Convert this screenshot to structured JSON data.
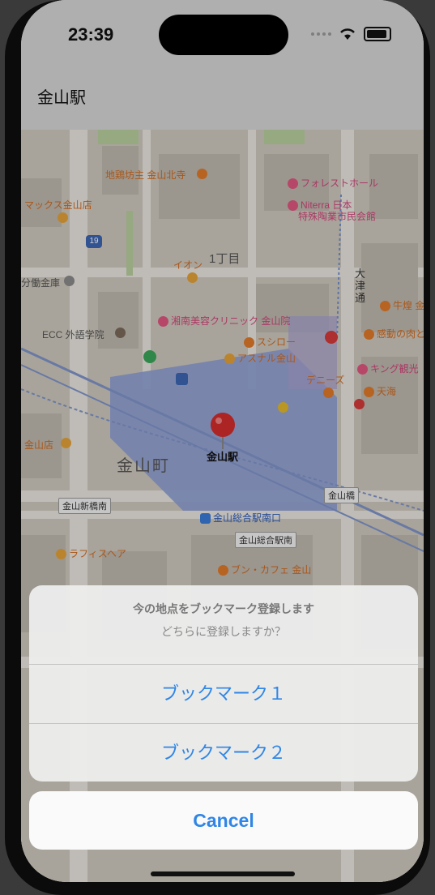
{
  "status_bar": {
    "time": "23:39"
  },
  "nav": {
    "title": "金山駅"
  },
  "map": {
    "pois": [
      {
        "label": "地鶏坊主 金山北寺",
        "color": "orange"
      },
      {
        "label": "フォレストホール",
        "color": "pink"
      },
      {
        "label": "Niterra 日本",
        "color": "pink"
      },
      {
        "label": "特殊陶業市民会館",
        "color": "pink"
      },
      {
        "label": "マックス金山店",
        "color": "orange"
      },
      {
        "label": "イオン",
        "color": "orange"
      },
      {
        "label": "湘南美容クリニック 金山院",
        "color": "pink"
      },
      {
        "label": "スシロー",
        "color": "orange"
      },
      {
        "label": "アスナル金山",
        "color": "orange"
      },
      {
        "label": "ECC 外語学院",
        "color": "gray"
      },
      {
        "label": "分働金庫",
        "color": "gray"
      },
      {
        "label": "牛煌 金",
        "color": "orange"
      },
      {
        "label": "感動の肉と",
        "color": "orange"
      },
      {
        "label": "キング観光",
        "color": "pink"
      },
      {
        "label": "デニーズ",
        "color": "orange"
      },
      {
        "label": "天海",
        "color": "orange"
      },
      {
        "label": "金山店",
        "color": "orange"
      },
      {
        "label": "ラフィスヘア",
        "color": "orange"
      },
      {
        "label": "ブン・カフェ 金山",
        "color": "orange"
      }
    ],
    "chome": "1丁目",
    "area": "金山町",
    "street": "大津通",
    "route_number": "19",
    "signs": [
      "金山新橋南",
      "金山橋",
      "金山総合駅南"
    ],
    "bus_stop": "金山総合駅南口",
    "station_pin_label": "金山駅"
  },
  "action_sheet": {
    "title": "今の地点をブックマーク登録します",
    "message": "どちらに登録しますか？",
    "actions": [
      "ブックマーク１",
      "ブックマーク２"
    ],
    "cancel": "Cancel"
  },
  "colors": {
    "accent": "#2f86e6",
    "poi_orange": "#d06a1f",
    "poi_pink": "#d0457a"
  }
}
